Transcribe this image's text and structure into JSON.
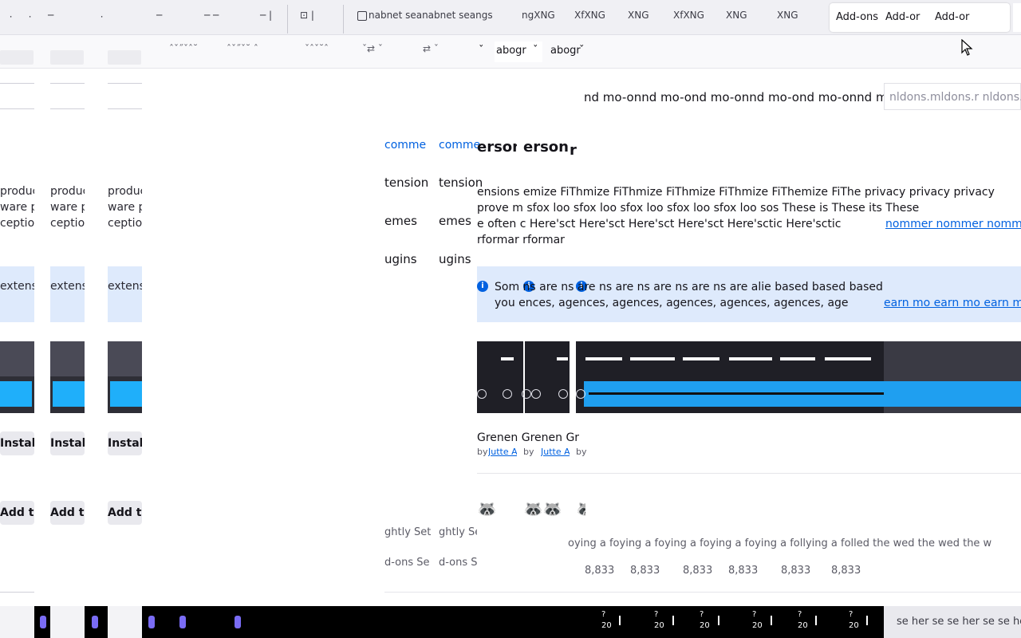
{
  "tabs": {
    "frag_icons": [
      "⸱",
      "⸱",
      "─",
      "⸱",
      "─",
      "─ ─",
      "─ |",
      "⊡ |"
    ],
    "search_tab": "nabnet seanabnet seangs",
    "xng": [
      "ngXNG",
      "XfXNG",
      "XNG",
      "XfXNG",
      "XNG",
      "XNG"
    ],
    "active_tab": [
      "Add-ons",
      "Add-or",
      "Add-or"
    ]
  },
  "toolbar": {
    "ghost_items": [
      "ˆˇ˝ˇˆ˘",
      "ˆˇ˝ˇ˘ ˆ",
      "ˇˆˇ˘ˆ",
      "ˇ⇄ ˇ",
      "⇄ ˇ"
    ],
    "dropdown_chevron": "ˇ",
    "dropdown1": "abogr",
    "dropdown2": "abogr"
  },
  "left_columns": {
    "desc_lines": [
      "produc",
      "ware pr",
      "ception"
    ],
    "notice": "extensi",
    "install": "Install",
    "add_to": "Add to"
  },
  "find_bar": {
    "placeholder": "nldons.mldons.r  nldons.r"
  },
  "recommended_line": "nd mo-onnd mo-ond mo-onnd mo-ond mo-onnd mo-on",
  "categories": {
    "heading_link": "comme",
    "items": [
      "tension",
      "emes",
      "ugins"
    ],
    "footer_items": [
      "ghtly Set",
      "d-ons Se"
    ]
  },
  "personal_heading": "erson",
  "description": {
    "line1": "ensions   emize FiThmize FiThmize FiThmize FiThmize FiThemize FiThe privacy privacy privacy",
    "line2": "prove m   sfox loo sfox loo sfox loo sfox loo sfox loo sos These is These its These",
    "line3": "e often   c Here'sct  Here'sct  Here'sct  Here'sct  Here'sctic Here'sctic",
    "line3_link": "nommer nommer nommer",
    "line4": "rformar   rformar"
  },
  "notice": {
    "line1": "Som   ns are ns are ns are ns are ns are ns are alie based based based",
    "line2": "you   ences, agences, agences, agences, agences, agences, age",
    "learn_more": "earn mo earn mo earn mo"
  },
  "addon": {
    "name": "Grenen  Grenen  Gr",
    "by_label": "by",
    "author": "Jutte A",
    "fox_icon": "🦝",
    "follow_text": "oying a foying a foying a foying a foying a follying a folled the wed the wed the w",
    "users": [
      "8,833",
      "8,833",
      "8,833",
      "8,833",
      "8,833",
      "8,833"
    ]
  },
  "taskbar": {
    "times": [
      "?",
      "?",
      "?",
      "?",
      "?",
      "?"
    ],
    "years": [
      "20",
      "20",
      "20",
      "20",
      "20",
      "20"
    ],
    "search": "se her se se her se se her se"
  },
  "colors": {
    "accent": "#0061e0",
    "notice_bg": "#deeafc",
    "theme_blue": "#1faffa"
  }
}
